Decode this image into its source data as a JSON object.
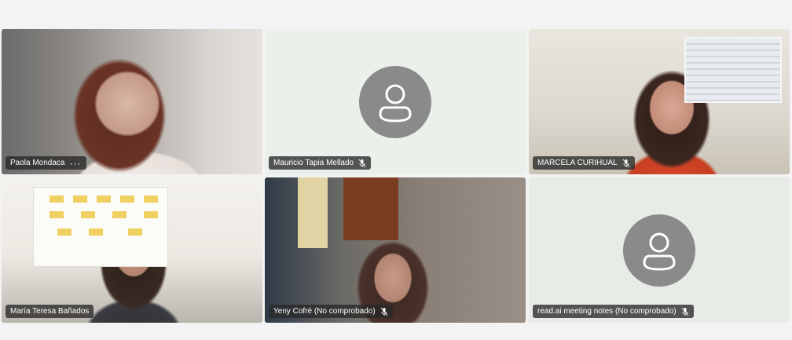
{
  "participants": [
    {
      "name": "Paola Mondaca",
      "muted": false,
      "has_more": true
    },
    {
      "name": "Mauricio Tapia Mellado",
      "muted": true
    },
    {
      "name": "MARCELA CURIHUAL",
      "muted": true
    },
    {
      "name": "María Teresa Bañados",
      "muted": false
    },
    {
      "name": "Yeny Cofré (No comprobado)",
      "muted": true
    },
    {
      "name": "read.ai meeting notes (No comprobado)",
      "muted": true
    }
  ],
  "icons": {
    "mic_off": "mic-off-icon",
    "more": "more-options-icon",
    "avatar": "person-avatar-icon"
  },
  "colors": {
    "avatar_bg": "#8a8a8a",
    "name_pill_bg": "rgba(40,40,40,0.78)"
  }
}
